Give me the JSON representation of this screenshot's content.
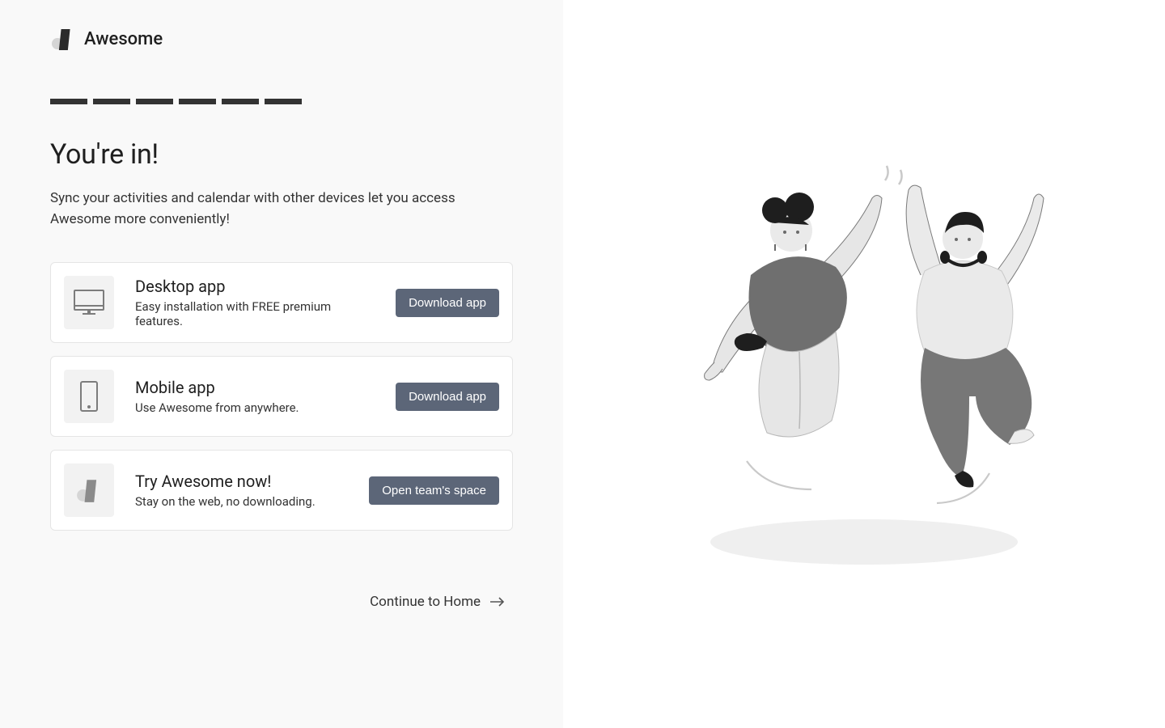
{
  "brand": {
    "name": "Awesome"
  },
  "progress": {
    "total_steps": 6,
    "current_step": 6
  },
  "headline": "You're in!",
  "subtext": "Sync your activities and calendar with other devices let you access Awesome more conveniently!",
  "cards": [
    {
      "title": "Desktop app",
      "desc": "Easy installation with FREE premium features.",
      "button": "Download app",
      "icon": "desktop"
    },
    {
      "title": "Mobile app",
      "desc": "Use Awesome from anywhere.",
      "button": "Download app",
      "icon": "mobile"
    },
    {
      "title": "Try Awesome now!",
      "desc": "Stay on the web, no downloading.",
      "button": "Open team's space",
      "icon": "logo"
    }
  ],
  "continue_label": "Continue to Home",
  "colors": {
    "button": "#5c6678",
    "panel_bg": "#f9f9f9",
    "border": "#e5e5e5",
    "progress": "#333333"
  }
}
